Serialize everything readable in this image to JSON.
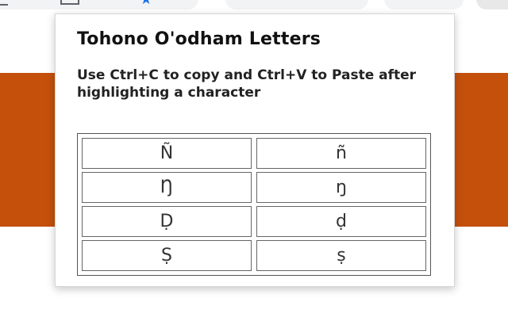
{
  "browser": {
    "toolbar_icons": [
      "tab-square-icon",
      "bookmark-star-icon",
      "extension-icon",
      "extension-icon"
    ]
  },
  "page": {
    "band_color": "#c4500b"
  },
  "popup": {
    "title": "Tohono O'odham Letters",
    "instructions": "Use Ctrl+C to copy and Ctrl+V to Paste after highlighting a character",
    "letters": [
      [
        "Ñ",
        "ñ"
      ],
      [
        "Ŋ",
        "ŋ"
      ],
      [
        "Ḍ",
        "ḍ"
      ],
      [
        "Ṣ",
        "ṣ"
      ]
    ]
  },
  "colors": {
    "accent_blue": "#1a73e8",
    "title_text": "#111111",
    "letter_text": "#333333"
  }
}
